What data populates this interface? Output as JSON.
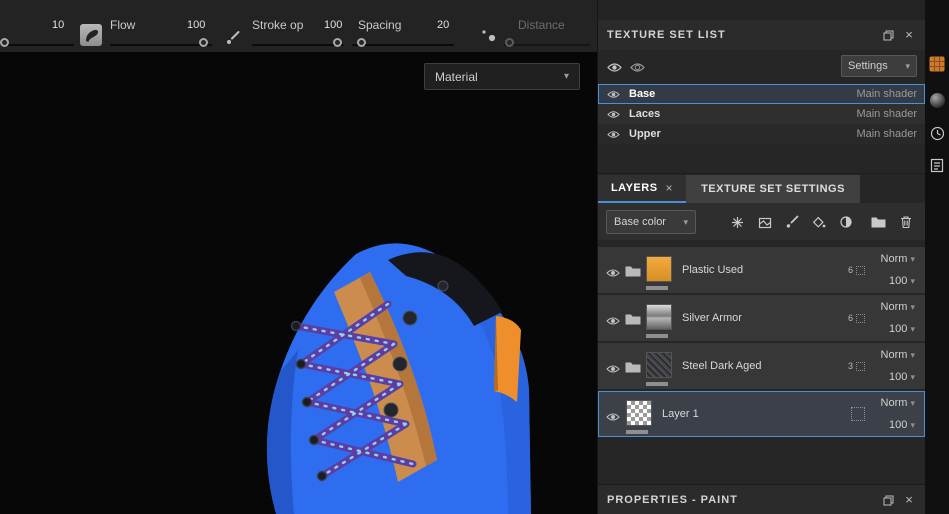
{
  "icons": {
    "close": "×",
    "caret": "▾"
  },
  "toolbar": {
    "size_value": "10",
    "flow_label": "Flow",
    "flow_value": "100",
    "stroke_label": "Stroke op",
    "stroke_value": "100",
    "spacing_label": "Spacing",
    "spacing_value": "20",
    "distance_label": "Distance"
  },
  "viewport": {
    "material_dropdown": "Material"
  },
  "texture_set_list": {
    "title": "TEXTURE SET LIST",
    "settings_dropdown": "Settings",
    "items": [
      {
        "name": "Base",
        "shader": "Main shader"
      },
      {
        "name": "Laces",
        "shader": "Main shader"
      },
      {
        "name": "Upper",
        "shader": "Main shader"
      }
    ]
  },
  "layers_panel": {
    "tab_layers": "LAYERS",
    "tab_settings": "TEXTURE SET SETTINGS",
    "blend_dropdown": "Base color",
    "rows": [
      {
        "name": "Plastic Used",
        "blend": "Norm",
        "opacity": "100",
        "count": "6"
      },
      {
        "name": "Silver Armor",
        "blend": "Norm",
        "opacity": "100",
        "count": "6"
      },
      {
        "name": "Steel Dark Aged",
        "blend": "Norm",
        "opacity": "100",
        "count": "3"
      },
      {
        "name": "Layer 1",
        "blend": "Norm",
        "opacity": "100",
        "count": ""
      }
    ]
  },
  "properties": {
    "title": "PROPERTIES - PAINT"
  },
  "colors": {
    "accent": "#4a90d9",
    "lace_blue": "#2e6cf0",
    "leather_orange": "#cb8c4e"
  }
}
